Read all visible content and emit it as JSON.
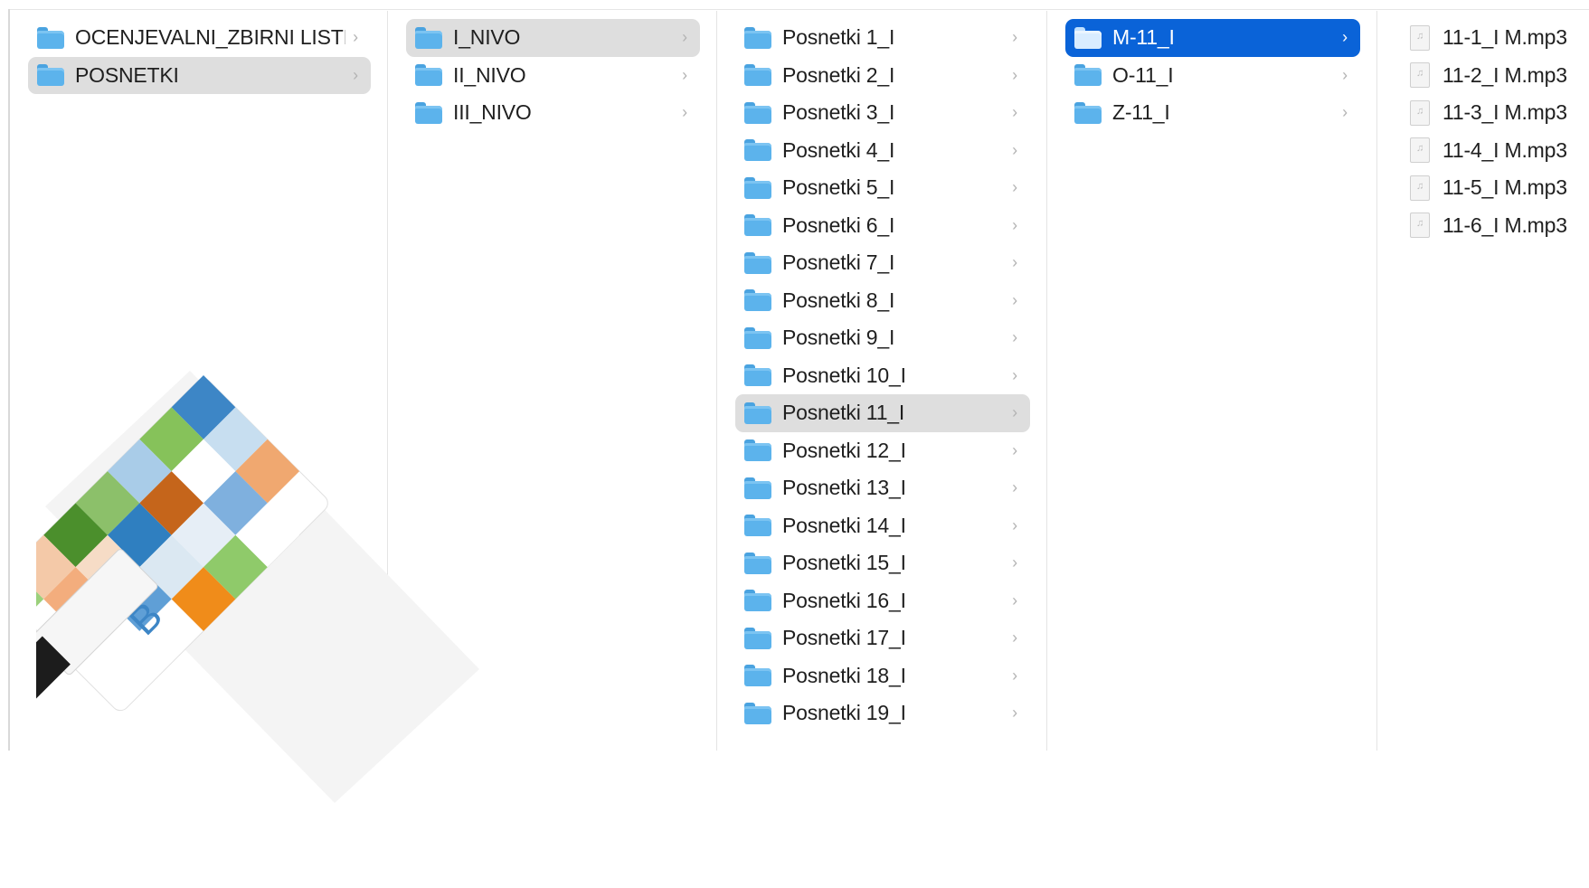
{
  "columns": [
    {
      "rows": [
        {
          "label": "OCENJEVALNI_ZBIRNI LISTI",
          "icon": "folder-icon",
          "state": "none"
        },
        {
          "label": "POSNETKI",
          "icon": "folder-icon",
          "state": "selected-inactive"
        }
      ]
    },
    {
      "rows": [
        {
          "label": "I_NIVO",
          "icon": "folder-icon",
          "state": "selected-inactive"
        },
        {
          "label": "II_NIVO",
          "icon": "folder-icon",
          "state": "none"
        },
        {
          "label": "III_NIVO",
          "icon": "folder-icon",
          "state": "none"
        }
      ]
    },
    {
      "rows": [
        {
          "label": "Posnetki 1_I",
          "icon": "folder-icon",
          "state": "none"
        },
        {
          "label": "Posnetki 2_I",
          "icon": "folder-icon",
          "state": "none"
        },
        {
          "label": "Posnetki 3_I",
          "icon": "folder-icon",
          "state": "none"
        },
        {
          "label": "Posnetki 4_I",
          "icon": "folder-icon",
          "state": "none"
        },
        {
          "label": "Posnetki 5_I",
          "icon": "folder-icon",
          "state": "none"
        },
        {
          "label": "Posnetki 6_I",
          "icon": "folder-icon",
          "state": "none"
        },
        {
          "label": "Posnetki 7_I",
          "icon": "folder-icon",
          "state": "none"
        },
        {
          "label": "Posnetki 8_I",
          "icon": "folder-icon",
          "state": "none"
        },
        {
          "label": "Posnetki 9_I",
          "icon": "folder-icon",
          "state": "none"
        },
        {
          "label": "Posnetki 10_I",
          "icon": "folder-icon",
          "state": "none"
        },
        {
          "label": "Posnetki 11_I",
          "icon": "folder-icon",
          "state": "selected-inactive"
        },
        {
          "label": "Posnetki 12_I",
          "icon": "folder-icon",
          "state": "none"
        },
        {
          "label": "Posnetki 13_I",
          "icon": "folder-icon",
          "state": "none"
        },
        {
          "label": "Posnetki 14_I",
          "icon": "folder-icon",
          "state": "none"
        },
        {
          "label": "Posnetki 15_I",
          "icon": "folder-icon",
          "state": "none"
        },
        {
          "label": "Posnetki 16_I",
          "icon": "folder-icon",
          "state": "none"
        },
        {
          "label": "Posnetki 17_I",
          "icon": "folder-icon",
          "state": "none"
        },
        {
          "label": "Posnetki 18_I",
          "icon": "folder-icon",
          "state": "none"
        },
        {
          "label": "Posnetki 19_I",
          "icon": "folder-icon",
          "state": "none"
        }
      ]
    },
    {
      "rows": [
        {
          "label": "M-11_I",
          "icon": "folder-icon",
          "state": "selected-active"
        },
        {
          "label": "O-11_I",
          "icon": "folder-icon",
          "state": "none"
        },
        {
          "label": "Z-11_I",
          "icon": "folder-icon",
          "state": "none"
        }
      ]
    },
    {
      "rows": [
        {
          "label": "11-1_I M.mp3",
          "icon": "audio-file-icon",
          "state": "none"
        },
        {
          "label": "11-2_I M.mp3",
          "icon": "audio-file-icon",
          "state": "none"
        },
        {
          "label": "11-3_I M.mp3",
          "icon": "audio-file-icon",
          "state": "none"
        },
        {
          "label": "11-4_I M.mp3",
          "icon": "audio-file-icon",
          "state": "none"
        },
        {
          "label": "11-5_I M.mp3",
          "icon": "audio-file-icon",
          "state": "none"
        },
        {
          "label": "11-6_I M.mp3",
          "icon": "audio-file-icon",
          "state": "none"
        }
      ]
    }
  ],
  "colors": {
    "selection_active": "#0a63d8",
    "selection_inactive": "#dedede",
    "folder": "#5cb3ec"
  },
  "usb_card": {
    "letters": [
      "B",
      "P"
    ]
  }
}
